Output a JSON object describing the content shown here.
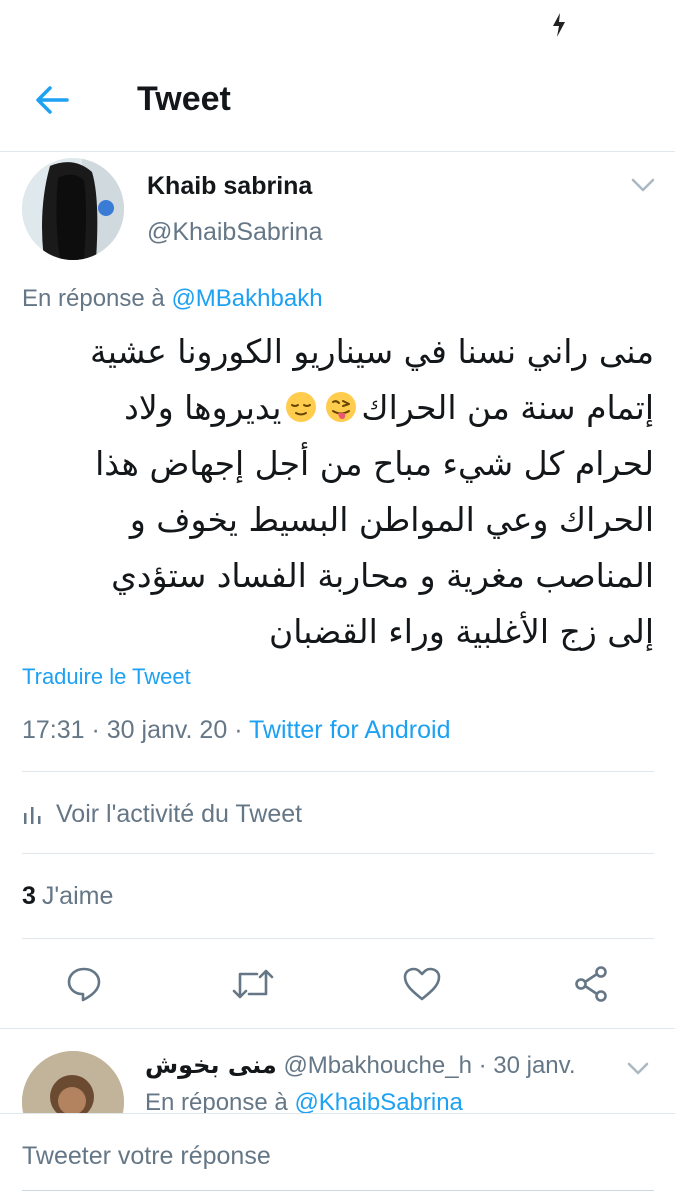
{
  "header": {
    "title": "Tweet"
  },
  "tweet": {
    "author_name": "Khaib sabrina",
    "author_handle": "@KhaibSabrina",
    "reply_prefix": "En réponse à ",
    "reply_mention": "@MBakhbakh",
    "text_lines": [
      "منى راني نسنا في سيناريو الكورونا عشية",
      "إتمام سنة من الحراك",
      "يديروها ولاد",
      "لحرام كل شيء مباح من أجل إجهاض هذا",
      "الحراك وعي المواطن البسيط يخوف و",
      "المناصب مغرية و محاربة الفساد ستؤدي",
      "إلى زج الأغلبية وراء القضبان"
    ],
    "emojis": [
      "winking-face-with-tongue",
      "relieved-face"
    ],
    "translate_label": "Traduire le Tweet",
    "time": "17:31",
    "date": "30 janv. 20",
    "separator": " · ",
    "source": "Twitter for Android",
    "activity_label": "Voir l'activité du Tweet",
    "likes_count": "3",
    "likes_label": "J'aime"
  },
  "reply": {
    "author_name": "منى بخوش",
    "handle": "@Mbakhouche_h",
    "date": "30 janv.",
    "separator": " · ",
    "reply_prefix": "En réponse à ",
    "reply_mention": "@KhaibSabrina"
  },
  "composer": {
    "placeholder": "Tweeter votre réponse"
  },
  "colors": {
    "accent": "#1da1f2",
    "secondary_text": "#657786",
    "primary_text": "#14171a",
    "divider": "#e1e8ed"
  },
  "icons": [
    "flash-icon",
    "back-arrow-icon",
    "chevron-down-icon",
    "stats-icon",
    "reply-icon",
    "retweet-icon",
    "like-icon",
    "share-icon"
  ]
}
